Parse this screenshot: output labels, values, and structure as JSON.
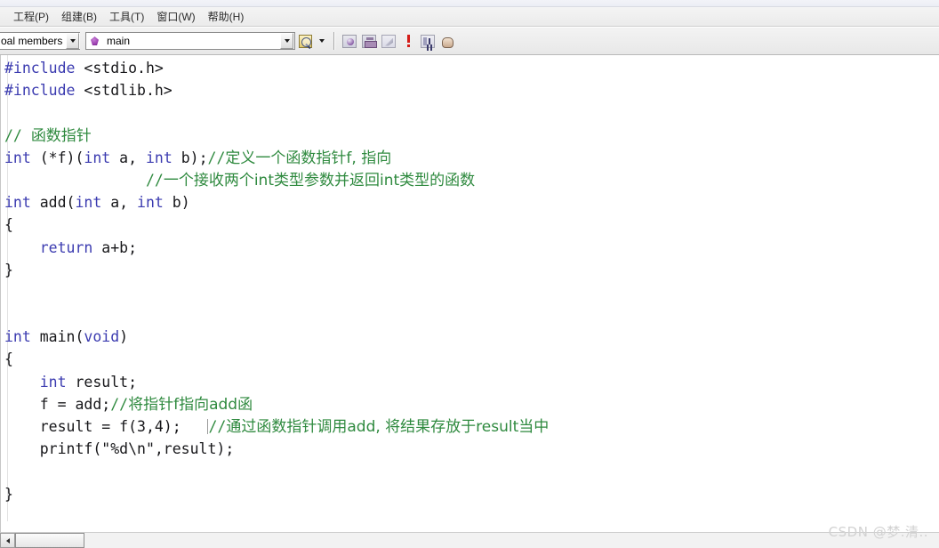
{
  "window": {
    "app_kind": "c-ide-code-editor"
  },
  "menubar": {
    "items": [
      {
        "label": "工程(P)",
        "name": "menu-project"
      },
      {
        "label": "组建(B)",
        "name": "menu-build"
      },
      {
        "label": "工具(T)",
        "name": "menu-tools"
      },
      {
        "label": "窗口(W)",
        "name": "menu-window"
      },
      {
        "label": "帮助(H)",
        "name": "menu-help"
      }
    ]
  },
  "toolbar": {
    "members_combo": {
      "value": "oal members",
      "icon": "chevron-down-icon"
    },
    "symbol_combo": {
      "value": "main",
      "icon": "member-symbol-icon"
    },
    "buttons": [
      {
        "name": "find-in-files-button",
        "icon": "find-icon"
      },
      {
        "name": "find-dropdown-button",
        "icon": "chevron-down-icon"
      },
      {
        "name": "compile-button",
        "icon": "compile-icon"
      },
      {
        "name": "build-button",
        "icon": "build-icon"
      },
      {
        "name": "build-execute-button",
        "icon": "link-icon"
      },
      {
        "name": "stop-build-button",
        "icon": "exclamation-icon"
      },
      {
        "name": "step-into-button",
        "icon": "step-into-icon"
      },
      {
        "name": "insert-remove-breakpoint-button",
        "icon": "hand-icon"
      }
    ]
  },
  "code": {
    "lines": [
      {
        "n": 1,
        "segments": [
          {
            "t": "#include ",
            "c": "pre"
          },
          {
            "t": "<stdio.h>",
            "c": "plain"
          }
        ]
      },
      {
        "n": 2,
        "segments": [
          {
            "t": "#include ",
            "c": "pre"
          },
          {
            "t": "<stdlib.h>",
            "c": "plain"
          }
        ]
      },
      {
        "n": 3,
        "segments": []
      },
      {
        "n": 4,
        "segments": [
          {
            "t": "// ",
            "c": "cmt"
          },
          {
            "t": "函数指针",
            "c": "cmt-cn"
          }
        ]
      },
      {
        "n": 5,
        "segments": [
          {
            "t": "int",
            "c": "kw"
          },
          {
            "t": " (*f)(",
            "c": "plain"
          },
          {
            "t": "int",
            "c": "kw"
          },
          {
            "t": " a, ",
            "c": "plain"
          },
          {
            "t": "int",
            "c": "kw"
          },
          {
            "t": " b);",
            "c": "plain"
          },
          {
            "t": "//",
            "c": "cmt"
          },
          {
            "t": "定义一个函数指针f, 指向",
            "c": "cmt-cn"
          }
        ]
      },
      {
        "n": 6,
        "segments": [
          {
            "t": "                ",
            "c": "plain"
          },
          {
            "t": "//",
            "c": "cmt"
          },
          {
            "t": "一个接收两个int类型参数并返回int类型的函数",
            "c": "cmt-cn"
          }
        ]
      },
      {
        "n": 7,
        "segments": [
          {
            "t": "int",
            "c": "kw"
          },
          {
            "t": " add(",
            "c": "plain"
          },
          {
            "t": "int",
            "c": "kw"
          },
          {
            "t": " a, ",
            "c": "plain"
          },
          {
            "t": "int",
            "c": "kw"
          },
          {
            "t": " b)",
            "c": "plain"
          }
        ]
      },
      {
        "n": 8,
        "segments": [
          {
            "t": "{",
            "c": "brace"
          }
        ]
      },
      {
        "n": 9,
        "segments": [
          {
            "t": "    ",
            "c": "plain"
          },
          {
            "t": "return",
            "c": "kw"
          },
          {
            "t": " a+b;",
            "c": "plain"
          }
        ]
      },
      {
        "n": 10,
        "segments": [
          {
            "t": "}",
            "c": "brace"
          }
        ]
      },
      {
        "n": 11,
        "segments": []
      },
      {
        "n": 12,
        "segments": []
      },
      {
        "n": 13,
        "segments": [
          {
            "t": "int",
            "c": "kw"
          },
          {
            "t": " main(",
            "c": "plain"
          },
          {
            "t": "void",
            "c": "kw"
          },
          {
            "t": ")",
            "c": "plain"
          }
        ]
      },
      {
        "n": 14,
        "segments": [
          {
            "t": "{",
            "c": "brace"
          }
        ]
      },
      {
        "n": 15,
        "segments": [
          {
            "t": "    ",
            "c": "plain"
          },
          {
            "t": "int",
            "c": "kw"
          },
          {
            "t": " result;",
            "c": "plain"
          }
        ]
      },
      {
        "n": 16,
        "segments": [
          {
            "t": "    f = add;",
            "c": "plain"
          },
          {
            "t": "//",
            "c": "cmt"
          },
          {
            "t": "将指针f指向add函",
            "c": "cmt-cn"
          }
        ]
      },
      {
        "n": 17,
        "segments": [
          {
            "t": "    result = f(3,4);   ",
            "c": "plain"
          },
          {
            "t": "|",
            "c": "caret"
          },
          {
            "t": "//",
            "c": "cmt"
          },
          {
            "t": "通过函数指针调用add, 将结果存放于result当中",
            "c": "cmt-cn"
          }
        ]
      },
      {
        "n": 18,
        "segments": [
          {
            "t": "    printf(\"%d\\n\",result);",
            "c": "plain"
          }
        ]
      },
      {
        "n": 19,
        "segments": []
      },
      {
        "n": 20,
        "segments": [
          {
            "t": "}",
            "c": "brace"
          }
        ]
      }
    ],
    "colors": {
      "keyword": "#3b3bb0",
      "preprocessor": "#3b3bb0",
      "comment": "#2f8a3f",
      "plain": "#17171a",
      "background": "#ffffff"
    }
  },
  "scrollbar": {
    "left_arrow_icon": "triangle-left-icon"
  },
  "watermark": {
    "text": "CSDN @梦.清.."
  }
}
